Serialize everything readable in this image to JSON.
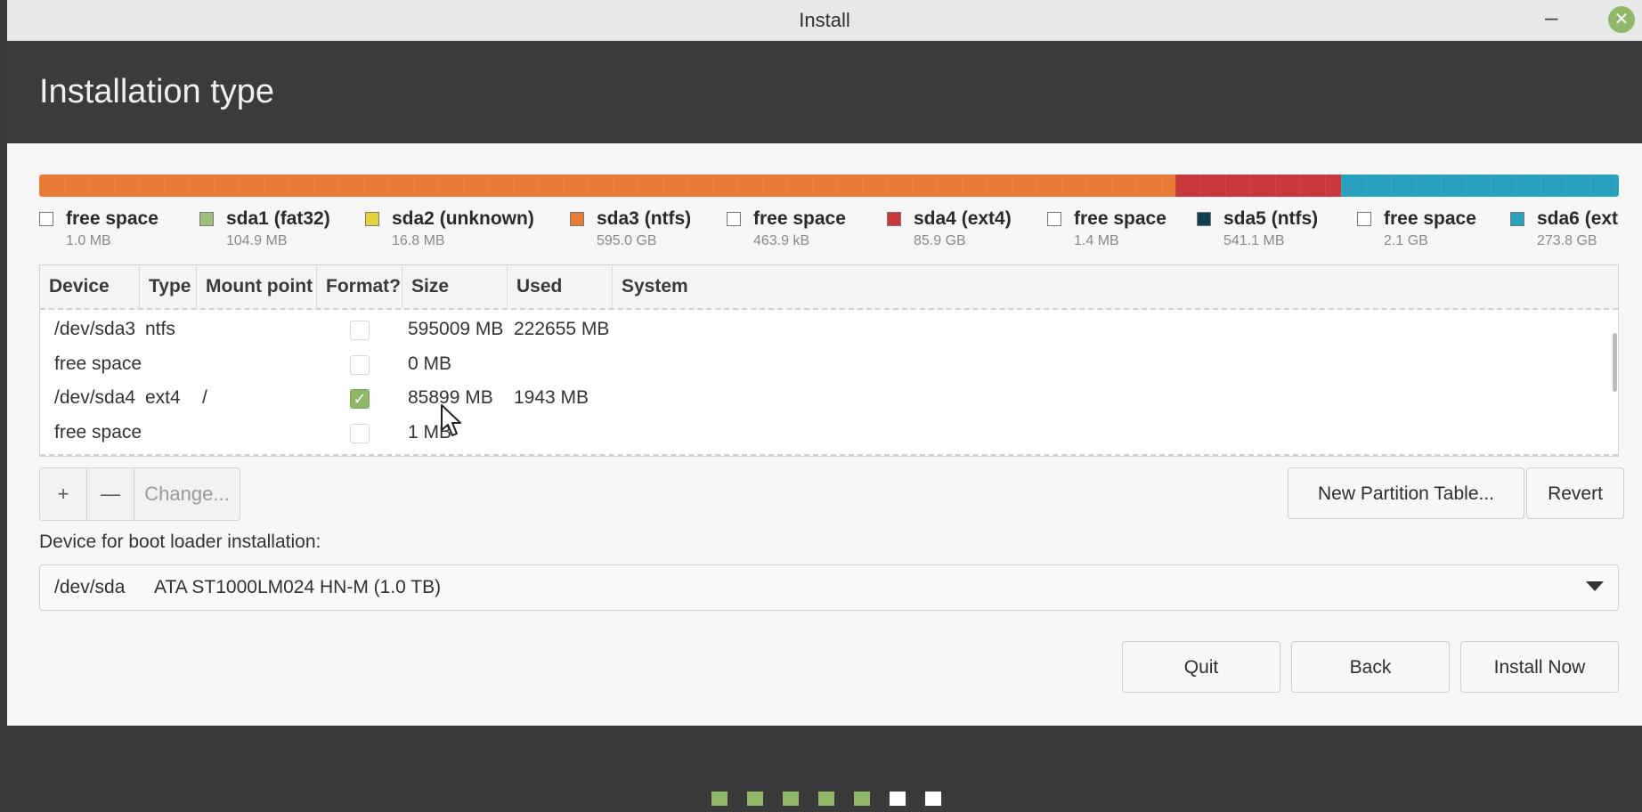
{
  "window": {
    "title": "Install"
  },
  "header": {
    "title": "Installation type"
  },
  "partition_bar": [
    {
      "color": "#e87b35"
    },
    {
      "color": "#c8373a"
    },
    {
      "color": "#2aa0bf"
    }
  ],
  "legend": [
    {
      "name": "free space",
      "size": "1.0 MB",
      "color": "#ffffff"
    },
    {
      "name": "sda1 (fat32)",
      "size": "104.9 MB",
      "color": "#9dbf7c"
    },
    {
      "name": "sda2 (unknown)",
      "size": "16.8 MB",
      "color": "#e5d33d"
    },
    {
      "name": "sda3 (ntfs)",
      "size": "595.0 GB",
      "color": "#e87b35"
    },
    {
      "name": "free space",
      "size": "463.9 kB",
      "color": "#ffffff"
    },
    {
      "name": "sda4 (ext4)",
      "size": "85.9 GB",
      "color": "#c8373a"
    },
    {
      "name": "free space",
      "size": "1.4 MB",
      "color": "#ffffff"
    },
    {
      "name": "sda5 (ntfs)",
      "size": "541.1 MB",
      "color": "#0f3e4e"
    },
    {
      "name": "free space",
      "size": "2.1 GB",
      "color": "#ffffff"
    },
    {
      "name": "sda6 (ext",
      "size": "273.8 GB",
      "color": "#2aa0bf"
    }
  ],
  "table": {
    "headers": [
      "Device",
      "Type",
      "Mount point",
      "Format?",
      "Size",
      "Used",
      "System"
    ],
    "rows": [
      {
        "device": "/dev/sda3",
        "type": "ntfs",
        "mount": "",
        "format": false,
        "size": "595009 MB",
        "used": "222655 MB",
        "system": ""
      },
      {
        "device": "free space",
        "type": "",
        "mount": "",
        "format": false,
        "size": "0 MB",
        "used": "",
        "system": ""
      },
      {
        "device": "/dev/sda4",
        "type": "ext4",
        "mount": "/",
        "format": true,
        "size": "85899 MB",
        "used": "1943 MB",
        "system": ""
      },
      {
        "device": "free space",
        "type": "",
        "mount": "",
        "format": false,
        "size": "1 MB",
        "used": "",
        "system": ""
      }
    ]
  },
  "toolbar": {
    "add": "+",
    "remove": "—",
    "change": "Change..."
  },
  "buttons": {
    "new_table": "New Partition Table...",
    "revert": "Revert",
    "quit": "Quit",
    "back": "Back",
    "install": "Install Now"
  },
  "boot": {
    "label": "Device for boot loader installation:",
    "device": "/dev/sda",
    "description": "ATA ST1000LM024 HN-M (1.0 TB)"
  },
  "progress": {
    "total_steps": 7,
    "completed": 5,
    "done_color": "#8fb869",
    "todo_color": "#ffffff"
  }
}
